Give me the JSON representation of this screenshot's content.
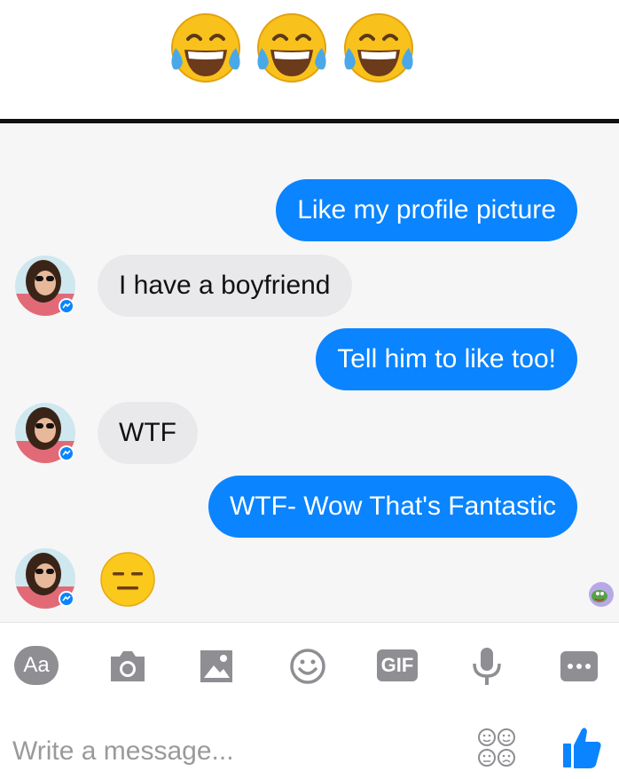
{
  "header": {
    "emoji_icons": [
      "tears-of-joy-icon",
      "tears-of-joy-icon",
      "tears-of-joy-icon"
    ]
  },
  "conversation": {
    "messages": [
      {
        "from": "me",
        "text": "Like my profile picture"
      },
      {
        "from": "them",
        "text": "I have a boyfriend"
      },
      {
        "from": "me",
        "text": "Tell him to like too!"
      },
      {
        "from": "them",
        "text": "WTF"
      },
      {
        "from": "me",
        "text": "WTF- Wow That's Fantastic"
      },
      {
        "from": "them",
        "emoji": "expressionless-face-icon"
      }
    ]
  },
  "composer": {
    "text_button_label": "Aa",
    "gif_label": "GIF",
    "placeholder": "Write a message..."
  },
  "colors": {
    "sent_bubble": "#0a84ff",
    "received_bubble": "#e9e9eb",
    "toolbar_icons": "#8e8e93",
    "like_thumb": "#0a84ff"
  }
}
